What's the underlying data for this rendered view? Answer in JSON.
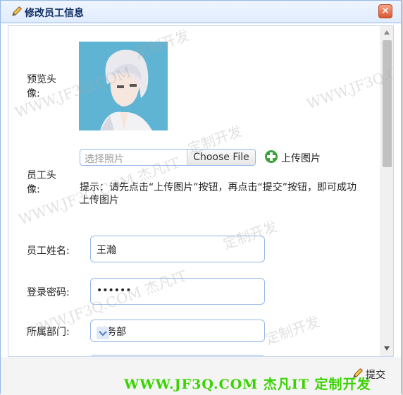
{
  "dialog": {
    "title": "修改员工信息",
    "close_glyph": "✕"
  },
  "form": {
    "preview_label": "预览头像:",
    "avatar_label": "员工头像:",
    "file_placeholder": "选择照片",
    "file_button": "Choose File",
    "upload_button": "上传图片",
    "hint": "提示：请先点击“上传图片”按钮，再点击“提交”按钮，即可成功上传图片",
    "name_label": "员工姓名:",
    "name_value": "王瀚",
    "password_label": "登录密码:",
    "password_value": "••••••",
    "department_label": "所属部门:",
    "department_value": "财务部"
  },
  "footer": {
    "submit_label": "提交",
    "brand_text": "WWW.JF3Q.COM 杰凡IT  定制开发"
  },
  "watermarks": {
    "custom_dev": "定制开发",
    "site_brand": "WWW.JF3Q.COM 杰凡IT",
    "site_url": "WWW.JF3Q.COM"
  },
  "icons": {
    "title": "pencil-icon",
    "upload": "green-plus-icon",
    "submit": "pencil-icon",
    "close": "close-icon"
  },
  "colors": {
    "title_bar": "#e0ecff",
    "border": "#95b8e7",
    "close": "#d9582f",
    "brand": "#39d300"
  }
}
